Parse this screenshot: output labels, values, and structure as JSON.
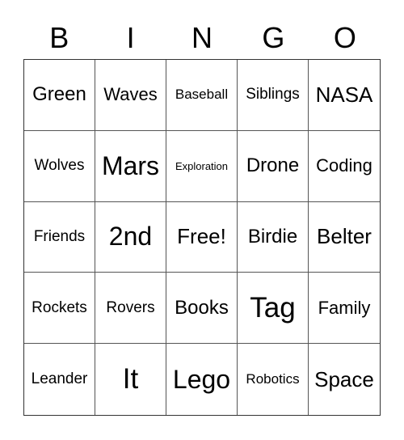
{
  "header": [
    "B",
    "I",
    "N",
    "G",
    "O"
  ],
  "cells": [
    "Green",
    "Waves",
    "Baseball",
    "Siblings",
    "NASA",
    "Wolves",
    "Mars",
    "Exploration",
    "Drone",
    "Coding",
    "Friends",
    "2nd",
    "Free!",
    "Birdie",
    "Belter",
    "Rockets",
    "Rovers",
    "Books",
    "Tag",
    "Family",
    "Leander",
    "It",
    "Lego",
    "Robotics",
    "Space"
  ]
}
